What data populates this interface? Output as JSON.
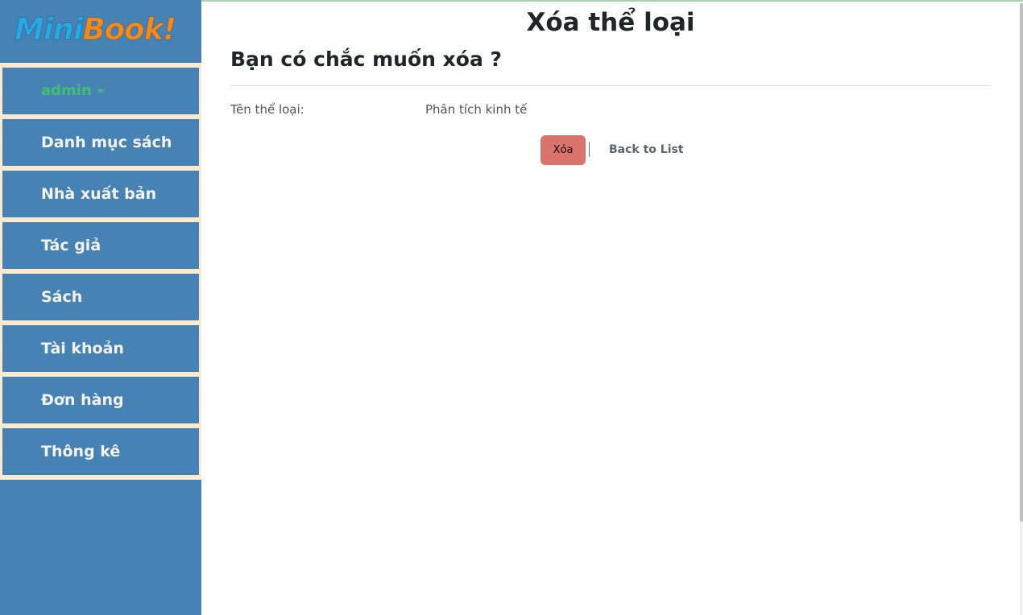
{
  "logo": {
    "part1": "Mini",
    "part2": "Book!"
  },
  "sidebar": {
    "user": "admin",
    "items": [
      {
        "label": "Danh mục sách"
      },
      {
        "label": "Nhà xuất bản"
      },
      {
        "label": "Tác giả"
      },
      {
        "label": "Sách"
      },
      {
        "label": "Tài khoản"
      },
      {
        "label": "Đơn hàng"
      },
      {
        "label": "Thông kê"
      }
    ]
  },
  "main": {
    "title": "Xóa thể loại",
    "confirm": "Bạn có chắc muốn xóa ?",
    "field_label": "Tên thể loại:",
    "field_value": "Phân tích kinh tế",
    "delete_label": "Xóa",
    "separator": "|",
    "back_label": "Back to List"
  },
  "colors": {
    "sidebar": "#4682b4",
    "menu_gap": "#fbead0",
    "delete_button": "#d9736c",
    "user_text": "#3fbf73"
  }
}
